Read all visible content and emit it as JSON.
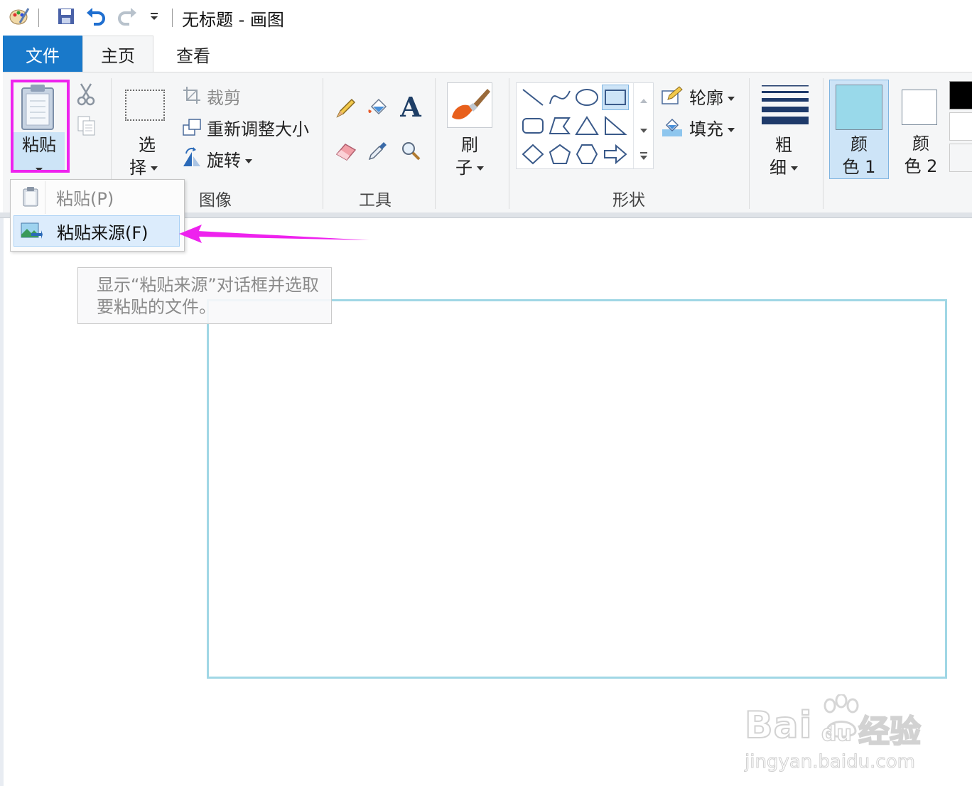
{
  "titlebar": {
    "title": "无标题 - 画图",
    "icons": [
      "paint-app-icon",
      "save-icon",
      "undo-icon",
      "redo-icon",
      "customize-qat-icon"
    ]
  },
  "tabs": [
    {
      "label": "文件"
    },
    {
      "label": "主页"
    },
    {
      "label": "查看"
    }
  ],
  "clipboard": {
    "paste_label": "粘贴",
    "group_label": ""
  },
  "image": {
    "select_label_1": "选",
    "select_label_2": "择",
    "crop_label": "裁剪",
    "resize_label": "重新调整大小",
    "rotate_label": "旋转",
    "group_label": "图像"
  },
  "tools": {
    "group_label": "工具"
  },
  "brushes": {
    "label_1": "刷",
    "label_2": "子"
  },
  "shapes": {
    "outline_label": "轮廓",
    "fill_label": "填充",
    "group_label": "形状"
  },
  "size": {
    "label_1": "粗",
    "label_2": "细"
  },
  "colors": {
    "color1_label_1": "颜",
    "color1_label_2": "色 1",
    "color2_label_1": "颜",
    "color2_label_2": "色 2",
    "color1_value": "#99d9ea",
    "color2_value": "#ffffff",
    "palette_first": "#000000",
    "highlight": "#ee22ee"
  },
  "paste_menu": {
    "paste_item": "粘贴(P)",
    "paste_from_item": "粘贴来源(F)"
  },
  "tooltip": {
    "line1": "显示“粘贴来源”对话框并选取",
    "line2": "要粘贴的文件。"
  },
  "watermark": {
    "brand": "Bai",
    "brand_suffix": "经验",
    "url": "jingyan.baidu.com"
  }
}
